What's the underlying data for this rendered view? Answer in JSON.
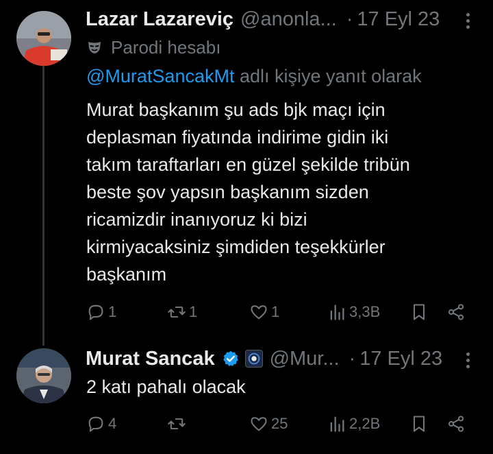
{
  "tweets": [
    {
      "author_name": "Lazar Lazareviç",
      "handle": "@anonla...",
      "separator": "·",
      "date": "17 Eyl 23",
      "label": "Parodi hesabı",
      "label_icon": "mask-icon",
      "reply_to": {
        "mention": "@MuratSancakMt",
        "suffix": " adlı kişiye yanıt olarak"
      },
      "lines": [
        "Murat başkanım şu ads bjk maçı için",
        "deplasman fiyatında indirime gidin iki",
        "takım taraftarları en güzel şekilde tribün",
        "beste şov yapsın başkanım sizden",
        "ricamizdir inanıyoruz ki bizi",
        "kirmiyacaksiniz şimdiden teşekkürler",
        "başkanım"
      ],
      "stats": {
        "replies": "1",
        "retweets": "1",
        "likes": "1",
        "views": "3,3B"
      }
    },
    {
      "author_name": "Murat Sancak",
      "handle": "@Mur...",
      "separator": "·",
      "date": "17 Eyl 23",
      "verified": true,
      "verified_color": "#1d9bf0",
      "lines": [
        "2 katı pahalı olacak"
      ],
      "stats": {
        "replies": "4",
        "retweets": "",
        "likes": "25",
        "views": "2,2B"
      }
    }
  ],
  "colors": {
    "background": "#000000",
    "text": "#e7e9ea",
    "muted": "#71767b",
    "link": "#1d9bf0"
  }
}
